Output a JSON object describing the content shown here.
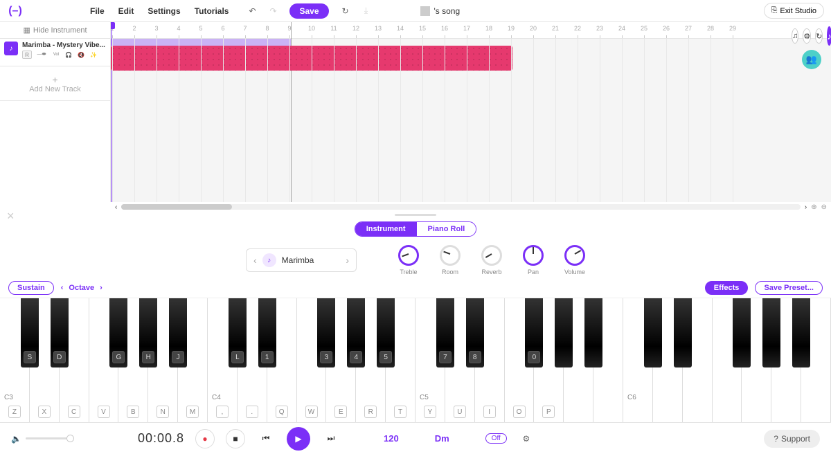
{
  "toolbar": {
    "menu": [
      "File",
      "Edit",
      "Settings",
      "Tutorials"
    ],
    "save_label": "Save",
    "song_title": "'s song",
    "exit_label": "Exit Studio"
  },
  "sidebar": {
    "hide_label": "Hide Instrument",
    "track": {
      "name": "Marimba - Mystery Vibe...",
      "rec_badge": "R",
      "vol_label": "Vol"
    },
    "add_track": "Add New Track"
  },
  "ruler_ticks": [
    "1",
    "2",
    "3",
    "4",
    "5",
    "6",
    "7",
    "8",
    "9",
    "10",
    "11",
    "12",
    "13",
    "14",
    "15",
    "16",
    "17",
    "18",
    "19",
    "20",
    "21",
    "22",
    "23",
    "24",
    "25",
    "26",
    "27",
    "28",
    "29"
  ],
  "panel": {
    "tab_instrument": "Instrument",
    "tab_pianoroll": "Piano Roll",
    "instrument_name": "Marimba",
    "knobs": [
      {
        "label": "Treble",
        "active": true,
        "rot": -110
      },
      {
        "label": "Room",
        "active": false,
        "rot": -70
      },
      {
        "label": "Reverb",
        "active": false,
        "rot": -120
      },
      {
        "label": "Pan",
        "active": true,
        "rot": 0
      },
      {
        "label": "Volume",
        "active": true,
        "rot": 60
      }
    ],
    "sustain": "Sustain",
    "octave_label": "Octave",
    "effects": "Effects",
    "save_preset": "Save Preset..."
  },
  "piano": {
    "white": [
      {
        "note": "C3",
        "key": "Z"
      },
      {
        "note": "",
        "key": "X"
      },
      {
        "note": "",
        "key": "C"
      },
      {
        "note": "",
        "key": "V"
      },
      {
        "note": "",
        "key": "B"
      },
      {
        "note": "",
        "key": "N"
      },
      {
        "note": "",
        "key": "M"
      },
      {
        "note": "C4",
        "key": ","
      },
      {
        "note": "",
        "key": "."
      },
      {
        "note": "",
        "key": "Q"
      },
      {
        "note": "",
        "key": "W"
      },
      {
        "note": "",
        "key": "E"
      },
      {
        "note": "",
        "key": "R"
      },
      {
        "note": "",
        "key": "T"
      },
      {
        "note": "C5",
        "key": "Y"
      },
      {
        "note": "",
        "key": "U"
      },
      {
        "note": "",
        "key": "I"
      },
      {
        "note": "",
        "key": "O"
      },
      {
        "note": "",
        "key": "P"
      },
      {
        "note": "",
        "key": ""
      },
      {
        "note": "",
        "key": ""
      },
      {
        "note": "C6",
        "key": ""
      },
      {
        "note": "",
        "key": ""
      },
      {
        "note": "",
        "key": ""
      },
      {
        "note": "",
        "key": ""
      },
      {
        "note": "",
        "key": ""
      },
      {
        "note": "",
        "key": ""
      },
      {
        "note": "",
        "key": ""
      }
    ],
    "black": [
      {
        "idx": 0,
        "key": "S"
      },
      {
        "idx": 1,
        "key": "D"
      },
      {
        "idx": 3,
        "key": "G"
      },
      {
        "idx": 4,
        "key": "H"
      },
      {
        "idx": 5,
        "key": "J"
      },
      {
        "idx": 7,
        "key": "L"
      },
      {
        "idx": 8,
        "key": "1"
      },
      {
        "idx": 10,
        "key": "3"
      },
      {
        "idx": 11,
        "key": "4"
      },
      {
        "idx": 12,
        "key": "5"
      },
      {
        "idx": 14,
        "key": "7"
      },
      {
        "idx": 15,
        "key": "8"
      },
      {
        "idx": 17,
        "key": "0"
      },
      {
        "idx": 18,
        "key": ""
      },
      {
        "idx": 19,
        "key": ""
      },
      {
        "idx": 21,
        "key": ""
      },
      {
        "idx": 22,
        "key": ""
      },
      {
        "idx": 24,
        "key": ""
      },
      {
        "idx": 25,
        "key": ""
      },
      {
        "idx": 26,
        "key": ""
      }
    ]
  },
  "transport": {
    "time": "00:00.8",
    "tempo": "120",
    "key": "Dm",
    "metronome": "Off",
    "support": "Support"
  }
}
